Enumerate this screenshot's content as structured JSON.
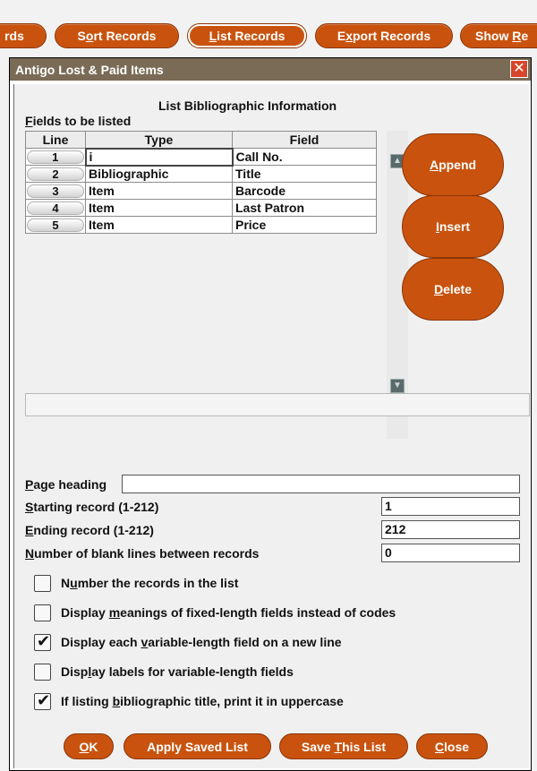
{
  "toolbar": {
    "tab_partial": "rds",
    "sort_prefix": "S",
    "sort_ul": "o",
    "sort_rest": "rt Records",
    "list_ul": "L",
    "list_rest": "ist Records",
    "export_pre": "E",
    "export_ul": "x",
    "export_rest": "port Records",
    "show_pre": "Show ",
    "show_ul": "R",
    "show_rest": "e"
  },
  "dialog": {
    "title": "Antigo Lost & Paid Items",
    "close_glyph": "✕",
    "header": "List Bibliographic Information",
    "fields_ul": "F",
    "fields_rest": "ields to be listed"
  },
  "grid": {
    "columns": [
      "Line",
      "Type",
      "Field"
    ],
    "rows": [
      {
        "line": "1",
        "type": "i",
        "field": "Call No."
      },
      {
        "line": "2",
        "type": "Bibliographic",
        "field": "Title"
      },
      {
        "line": "3",
        "type": "Item",
        "field": "Barcode"
      },
      {
        "line": "4",
        "type": "Item",
        "field": "Last Patron"
      },
      {
        "line": "5",
        "type": "Item",
        "field": "Price"
      }
    ]
  },
  "side_buttons": {
    "append_ul": "A",
    "append_rest": "ppend",
    "insert_ul": "I",
    "insert_rest": "nsert",
    "delete_ul": "D",
    "delete_rest": "elete"
  },
  "form": {
    "page_heading_ul": "P",
    "page_heading_rest": "age heading",
    "page_heading_value": "",
    "starting_ul": "S",
    "starting_rest": "tarting record (1-212)",
    "starting_value": "1",
    "ending_ul": "E",
    "ending_rest": "nding record (1-212)",
    "ending_value": "212",
    "blank_ul": "N",
    "blank_rest": "umber of blank lines between records",
    "blank_value": "0"
  },
  "checkboxes": [
    {
      "pre": "N",
      "ul": "u",
      "post": "mber the records in the list",
      "checked": false
    },
    {
      "pre": "Display ",
      "ul": "m",
      "post": "eanings of fixed-length fields instead of codes",
      "checked": false
    },
    {
      "pre": "Display each ",
      "ul": "v",
      "post": "ariable-length field on a new line",
      "checked": true
    },
    {
      "pre": "Disp",
      "ul": "l",
      "post": "ay labels for variable-length fields",
      "checked": false
    },
    {
      "pre": "If listing ",
      "ul": "b",
      "post": "ibliographic title, print it in uppercase",
      "checked": true
    }
  ],
  "bottom_buttons": {
    "ok_ul": "O",
    "ok_rest": "K",
    "apply_label": "Apply Saved List",
    "save_pre": "Save ",
    "save_ul": "T",
    "save_rest": "his List",
    "close_ul": "C",
    "close_rest": "lose"
  },
  "icons": {
    "checkmark": "✔",
    "scroll_up": "▲",
    "scroll_down": "▼"
  },
  "colors": {
    "accent": "#c9530e",
    "titlebar": "#7a6b56",
    "close": "#d7462a"
  }
}
